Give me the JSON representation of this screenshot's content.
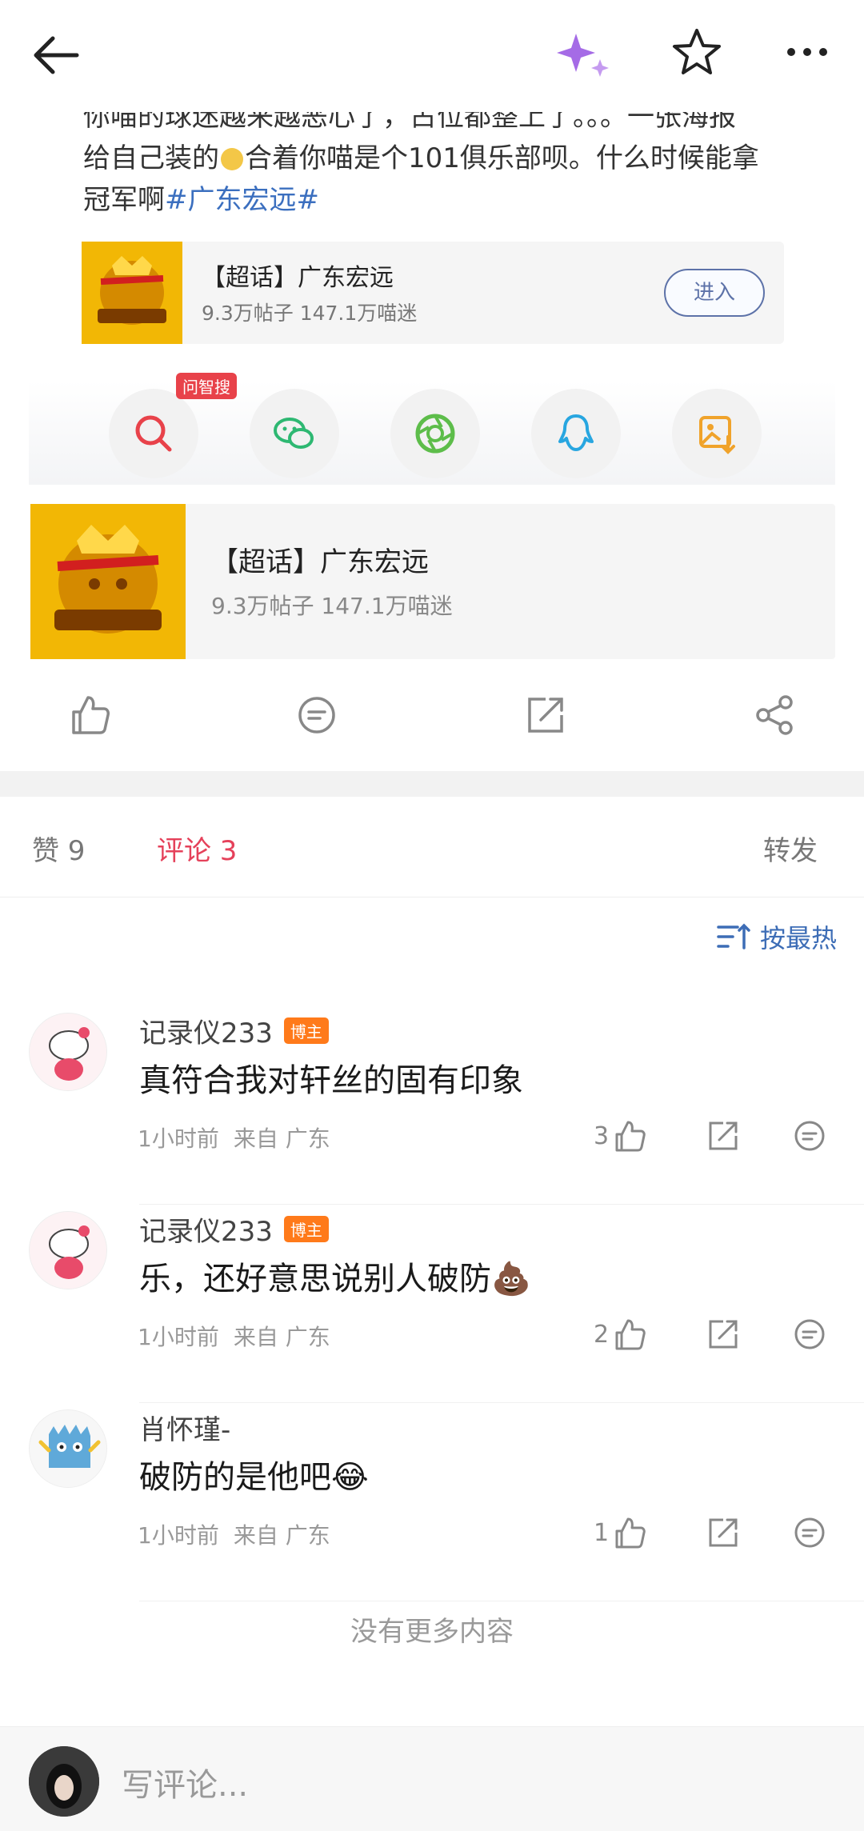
{
  "post": {
    "line1": "你喵的球迷越来越恶心了，占位都整上了。。。一张海报",
    "line2a": "给自己装的",
    "line2b": "合着你喵是个101俱乐部呗。什么时候能拿",
    "line3a": "冠军啊",
    "hashtag": "#广东宏远#"
  },
  "topic_small": {
    "title": "【超话】广东宏远",
    "stats": "9.3万帖子 147.1万喵迷",
    "enter_label": "进入"
  },
  "share": {
    "badge": "问智搜",
    "buttons": [
      "search-ai-icon",
      "wechat-icon",
      "moments-icon",
      "qq-icon",
      "save-image-icon"
    ]
  },
  "topic_large": {
    "title": "【超话】广东宏远",
    "stats": "9.3万帖子 147.1万喵迷"
  },
  "tabs": {
    "likes": "赞 9",
    "comments": "评论 3",
    "forward": "转发"
  },
  "sort_label": "按最热",
  "comments": [
    {
      "name": "记录仪233",
      "badge": "博主",
      "text": "真符合我对轩丝的固有印象",
      "time": "1小时前",
      "from": "来自 广东",
      "likes": "3",
      "emoji": ""
    },
    {
      "name": "记录仪233",
      "badge": "博主",
      "text": "乐，还好意思说别人破防",
      "time": "1小时前",
      "from": "来自 广东",
      "likes": "2",
      "emoji": "💩"
    },
    {
      "name": "肖怀瑾-",
      "badge": "",
      "text": "破防的是他吧",
      "time": "1小时前",
      "from": "来自 广东",
      "likes": "1",
      "emoji": "😂"
    }
  ],
  "no_more": "没有更多内容",
  "composer_placeholder": "写评论..."
}
